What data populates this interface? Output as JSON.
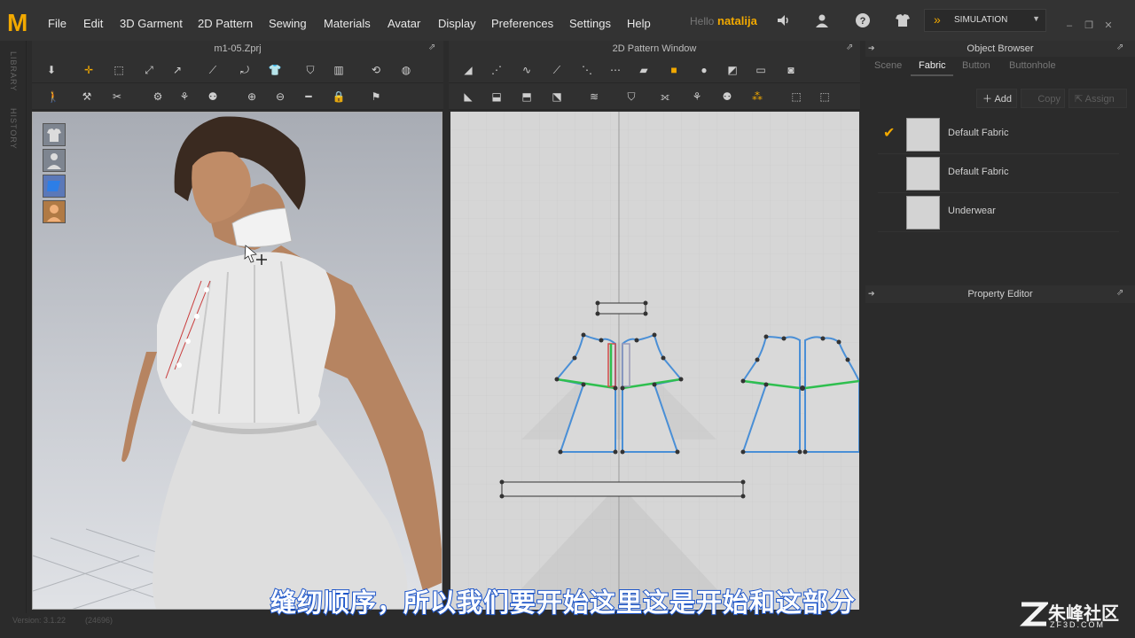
{
  "menu": {
    "items": [
      "File",
      "Edit",
      "3D Garment",
      "2D Pattern",
      "Sewing",
      "Materials",
      "Avatar",
      "Display",
      "Preferences",
      "Settings",
      "Help"
    ],
    "greeting": "Hello",
    "username": "natalija",
    "simulation_label": "SIMULATION"
  },
  "left_strip": {
    "library_label": "LIBRARY",
    "history_label": "HISTORY"
  },
  "view3d": {
    "title": "m1-05.Zprj"
  },
  "pattern_window": {
    "title": "2D Pattern Window"
  },
  "object_browser": {
    "title": "Object Browser",
    "tabs": [
      "Scene",
      "Fabric",
      "Button",
      "Buttonhole"
    ],
    "active_tab": "Fabric",
    "add_label": "Add",
    "copy_label": "Copy",
    "assign_label": "Assign",
    "fabrics": [
      {
        "name": "Default Fabric",
        "checked": true
      },
      {
        "name": "Default Fabric",
        "checked": false
      },
      {
        "name": "Underwear",
        "checked": false
      }
    ]
  },
  "property_editor": {
    "title": "Property Editor"
  },
  "status": {
    "version": "Version: 3.1.22",
    "build": "(24696)"
  },
  "subtitle": "缝纫顺序，所以我们要开始这里这是开始和这部分",
  "watermark": {
    "text": "朱峰社区",
    "url": "ZF3D.COM"
  },
  "colors": {
    "accent": "#f2a900",
    "subtitle_stroke": "#1e56c9",
    "seam_green": "#2fbf4f",
    "pattern_edge": "#4a8fd6"
  }
}
